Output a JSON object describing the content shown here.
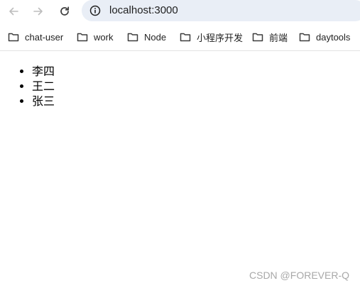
{
  "browser": {
    "url": "localhost:3000",
    "icons": {
      "back": "arrow-left-icon",
      "forward": "arrow-right-icon",
      "reload": "reload-icon",
      "site_info": "info-icon"
    },
    "bookmarks": [
      {
        "label": "chat-user",
        "icon": "folder-icon"
      },
      {
        "label": "work",
        "icon": "folder-icon"
      },
      {
        "label": "Node",
        "icon": "folder-icon"
      },
      {
        "label": "小程序开发",
        "icon": "folder-icon"
      },
      {
        "label": "前端",
        "icon": "folder-icon"
      },
      {
        "label": "daytools",
        "icon": "folder-icon"
      }
    ]
  },
  "page": {
    "list_items": [
      "李四",
      "王二",
      "张三"
    ]
  },
  "watermark": "CSDN @FOREVER-Q"
}
